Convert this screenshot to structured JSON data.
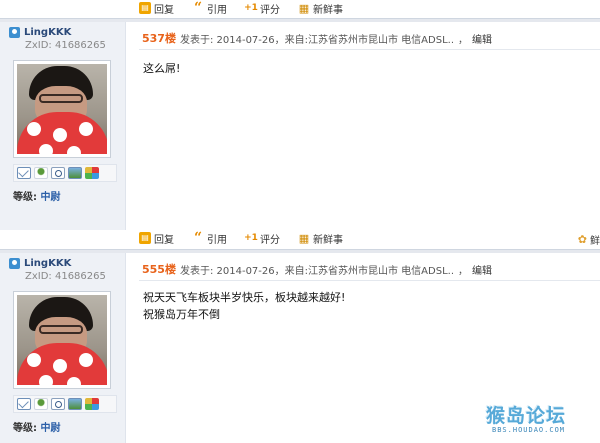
{
  "toolbar": {
    "reply": "回复",
    "quote": "引用",
    "rate": "评分",
    "fresh": "新鲜事"
  },
  "toolbar_right": {
    "label": "鲜"
  },
  "posts": [
    {
      "username": "LingKKK",
      "uid": "ZxID: 41686265",
      "level_label": "等级:",
      "level_value": "中尉",
      "floor": "537楼",
      "meta": "发表于: 2014-07-26，来自:江苏省苏州市昆山市 电信ADSL..",
      "edit": "编辑",
      "message_lines": [
        "这么屌!"
      ]
    },
    {
      "username": "LingKKK",
      "uid": "ZxID: 41686265",
      "level_label": "等级:",
      "level_value": "中尉",
      "floor": "555楼",
      "meta": "发表于: 2014-07-26，来自:江苏省苏州市昆山市 电信ADSL..",
      "edit": "编辑",
      "message_lines": [
        "祝天天飞车板块半岁快乐，板块越来越好!",
        "祝猴岛万年不倒"
      ]
    }
  ],
  "watermark": {
    "logo_text": "猴岛论坛",
    "url": "BBS.HOUDAO.COM"
  },
  "icons": {
    "reply": "reply-icon",
    "quote": "quote-icon",
    "rate": "rate-icon",
    "fresh": "fresh-news-icon",
    "user": "user-icon",
    "mail": "mail-icon",
    "friend": "add-friend-icon",
    "search": "search-icon",
    "photo": "photo-icon",
    "blocks": "blocks-icon"
  },
  "colors": {
    "floor": "#e8631b",
    "level": "#2b5fa8",
    "sidebar_bg": "#eef1f6"
  }
}
